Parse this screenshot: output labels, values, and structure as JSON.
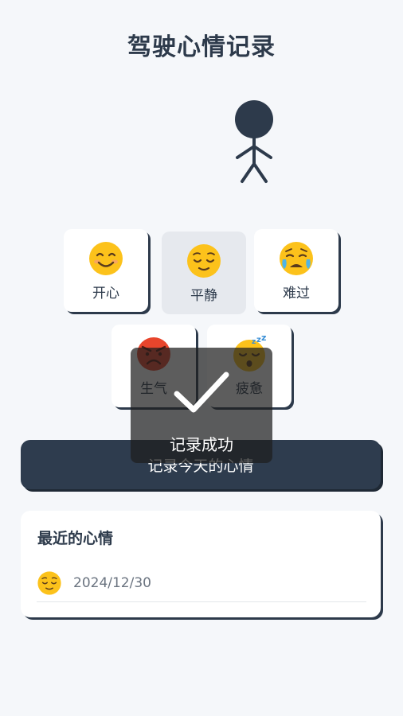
{
  "header": {
    "title": "驾驶心情记录"
  },
  "figure": {
    "icon": "stick-figure-icon",
    "color": "#2d3a4b"
  },
  "moods": [
    {
      "key": "happy",
      "label": "开心",
      "icon": "smiling-face-icon",
      "selected": false
    },
    {
      "key": "calm",
      "label": "平静",
      "icon": "relieved-face-icon",
      "selected": true
    },
    {
      "key": "sad",
      "label": "难过",
      "icon": "crying-face-icon",
      "selected": false
    },
    {
      "key": "angry",
      "label": "生气",
      "icon": "angry-face-icon",
      "selected": false
    },
    {
      "key": "tired",
      "label": "疲惫",
      "icon": "sleeping-face-icon",
      "selected": false
    }
  ],
  "record_button": {
    "label": "记录今天的心情",
    "color": "#2e3c4e"
  },
  "recent": {
    "title": "最近的心情",
    "entries": [
      {
        "icon": "relieved-face-icon",
        "date": "2024/12/30"
      }
    ]
  },
  "toast": {
    "text": "记录成功",
    "icon": "checkmark-icon"
  },
  "colors": {
    "background": "#f5f7fa",
    "primary": "#2d3a4b",
    "selected_card": "#e6e9ee",
    "emoji_yellow": "#fcc21b"
  }
}
